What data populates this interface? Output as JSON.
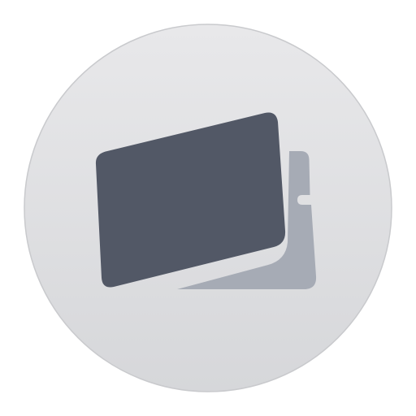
{
  "icon": {
    "name": "display-mirroring-app-icon",
    "colors": {
      "background": "#ffffff",
      "disc_top": "#e8e8ea",
      "disc_bottom": "#d6d7da",
      "disc_edge": "#c9cacd",
      "front_screen": "#525866",
      "back_screen": "#a6abb5"
    }
  }
}
